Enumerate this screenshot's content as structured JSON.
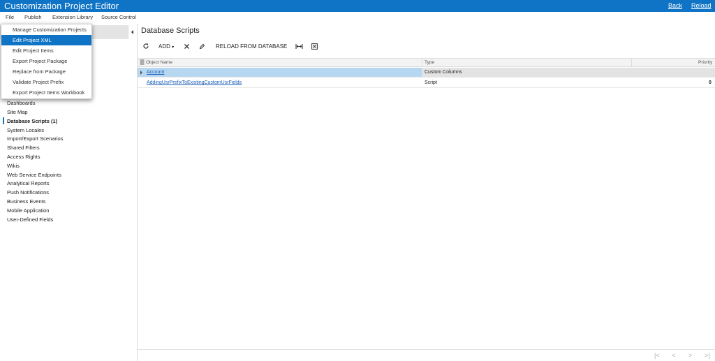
{
  "app": {
    "title": "Customization Project Editor",
    "back_label": "Back",
    "reload_label": "Reload"
  },
  "menubar": {
    "items": [
      "File",
      "Publish",
      "Extension Library",
      "Source Control"
    ]
  },
  "file_menu": {
    "items": [
      "Manage Customization Projects",
      "Edit Project XML",
      "Edit Project Items",
      "Export Project Package",
      "Replace from Package",
      "Validate Project Prefix",
      "Export Project Items Workbook"
    ],
    "selected_index": 1
  },
  "sidebar": {
    "items": [
      "Dashboards",
      "Site Map",
      "Database Scripts (1)",
      "System Locales",
      "Import/Export Scenarios",
      "Shared Filters",
      "Access Rights",
      "Wikis",
      "Web Service Endpoints",
      "Analytical Reports",
      "Push Notifications",
      "Business Events",
      "Mobile Application",
      "User-Defined Fields"
    ],
    "active_index": 2
  },
  "panel": {
    "title": "Database Scripts"
  },
  "toolbar": {
    "refresh_icon": "refresh-icon",
    "add_label": "ADD",
    "delete_icon": "close-icon",
    "edit_icon": "pencil-icon",
    "reload_db_label": "RELOAD FROM DATABASE",
    "fit_icon": "fit-columns-icon",
    "export_icon": "export-excel-icon"
  },
  "grid": {
    "columns": {
      "name": "Object Name",
      "type": "Type",
      "priority": "Priority"
    },
    "rows": [
      {
        "name": "Account",
        "type": "Custom Columns",
        "priority": ""
      },
      {
        "name": "AddingUsrPrefixToExistingCustomUsrFields",
        "type": "Script",
        "priority": "0"
      }
    ]
  },
  "pager": {
    "first": "|<",
    "prev": "<",
    "next": ">",
    "last": ">|"
  },
  "colors": {
    "accent": "#0f74c5",
    "selected_row": "#b7d7f1"
  }
}
